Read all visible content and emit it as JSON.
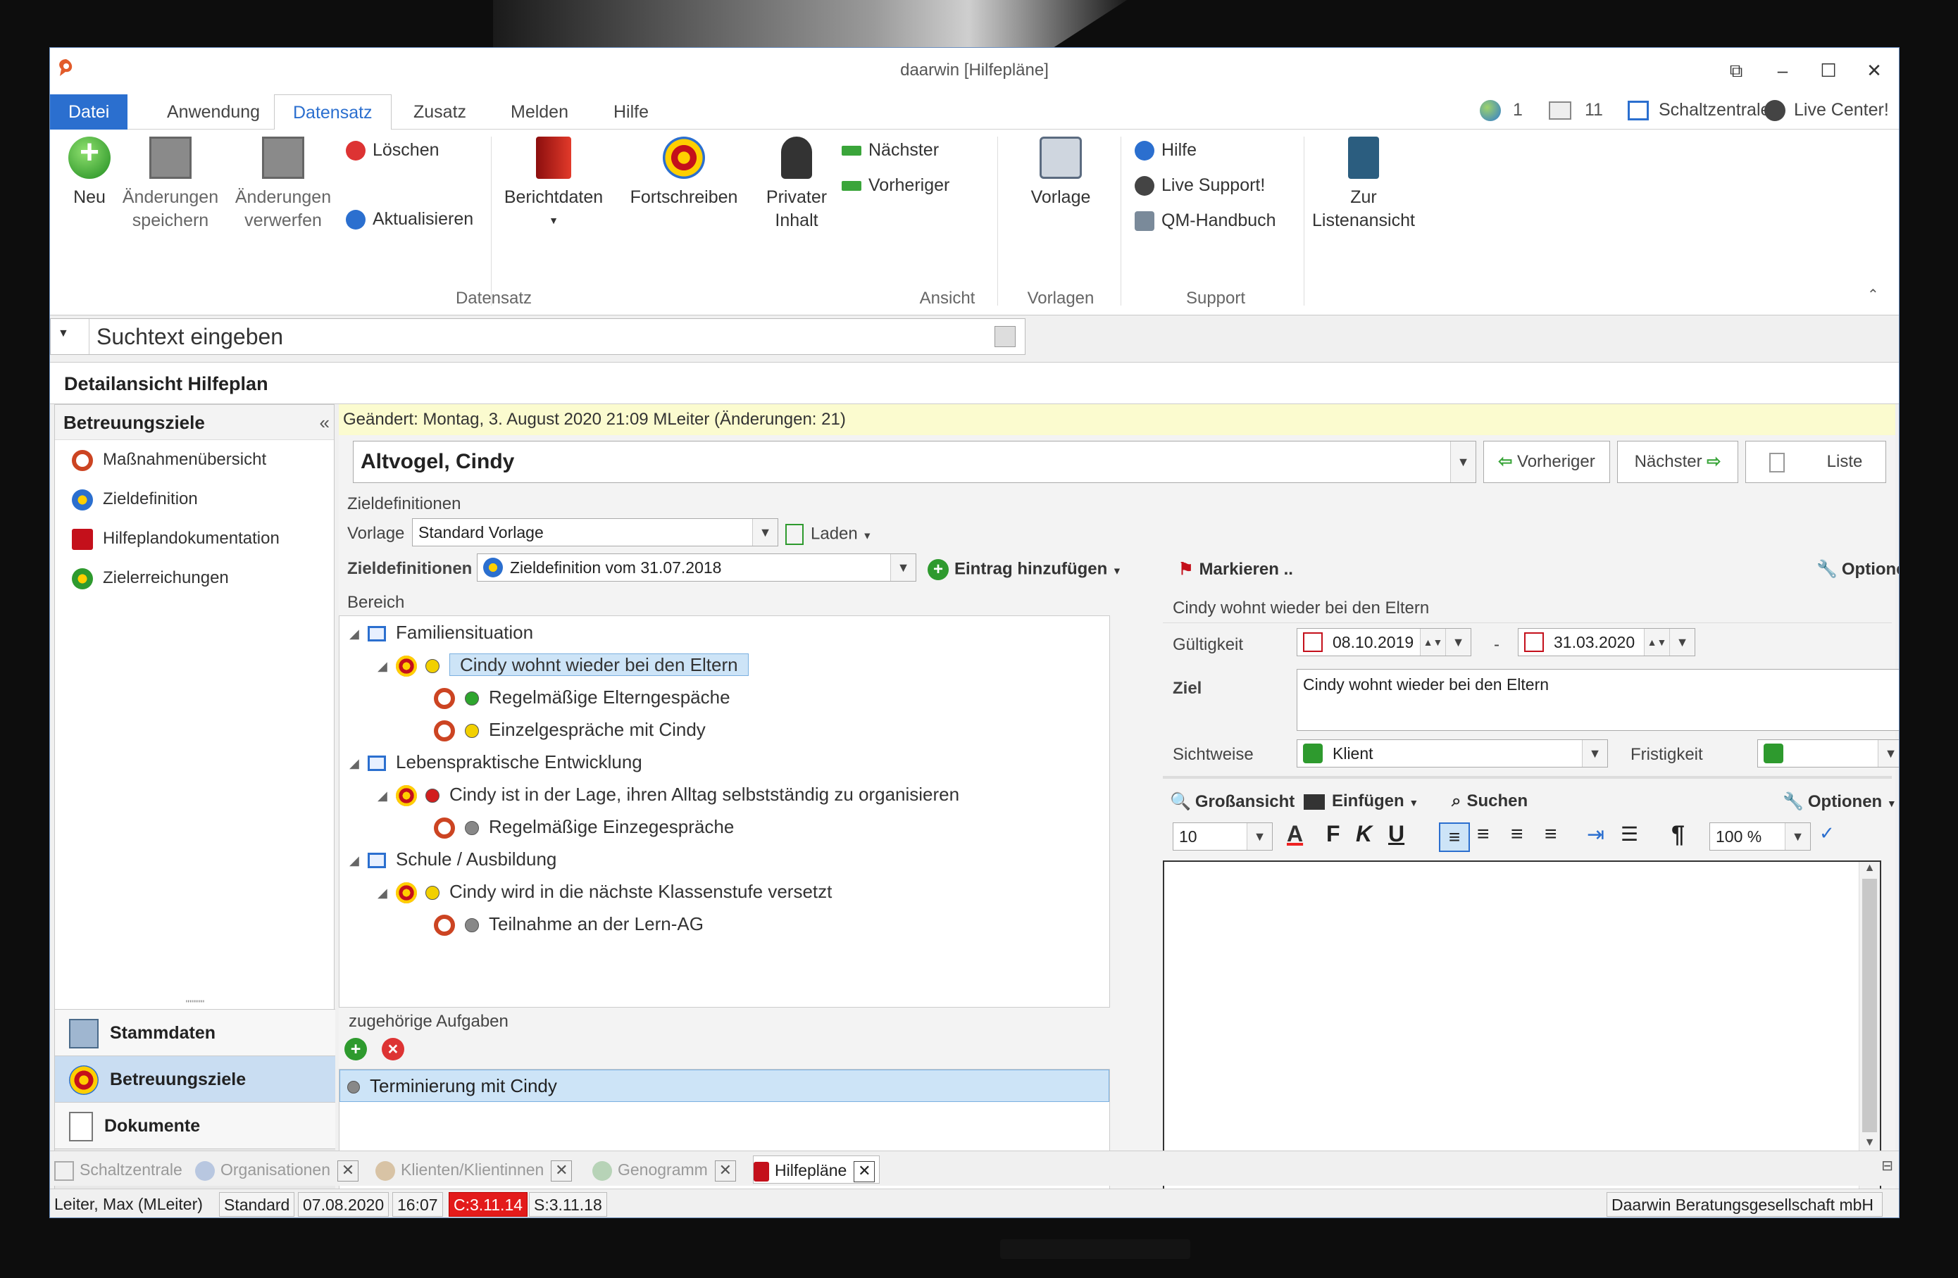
{
  "window": {
    "title": "daarwin [Hilfepläne]"
  },
  "ribbon_tabs": [
    "Datei",
    "Anwendung",
    "Datensatz",
    "Zusatz",
    "Melden",
    "Hilfe"
  ],
  "top_right": {
    "globe_count": "1",
    "mail_count": "11",
    "schaltzentrale": "Schaltzentrale",
    "live_center": "Live Center!"
  },
  "ribbon": {
    "neu": "Neu",
    "save_line1": "Änderungen",
    "save_line2": "speichern",
    "discard_line1": "Änderungen",
    "discard_line2": "verwerfen",
    "delete": "Löschen",
    "refresh": "Aktualisieren",
    "group_datensatz": "Datensatz",
    "berichtdaten": "Berichtdaten",
    "fortschreiben": "Fortschreiben",
    "privat_line1": "Privater",
    "privat_line2": "Inhalt",
    "next": "Nächster",
    "prev": "Vorheriger",
    "group_ansicht": "Ansicht",
    "vorlage": "Vorlage",
    "group_vorlagen": "Vorlagen",
    "hilfe": "Hilfe",
    "live_support": "Live Support!",
    "qm": "QM-Handbuch",
    "group_support": "Support",
    "list_line1": "Zur",
    "list_line2": "Listenansicht"
  },
  "search": {
    "placeholder": "Suchtext eingeben"
  },
  "detail_title": "Detailansicht Hilfeplan",
  "left": {
    "header": "Betreuungsziele",
    "items": [
      "Maßnahmenübersicht",
      "Zieldefinition",
      "Hilfeplandokumentation",
      "Zielerreichungen"
    ],
    "nav": [
      "Stammdaten",
      "Betreuungsziele",
      "Dokumente"
    ]
  },
  "main": {
    "changed": "Geändert: Montag, 3. August 2020 21:09  MLeiter  (Änderungen: 21)",
    "client": "Altvogel, Cindy",
    "btn_prev": "Vorheriger",
    "btn_next": "Nächster",
    "btn_list": "Liste",
    "section_title": "Zieldefinitionen",
    "vorlage_label": "Vorlage",
    "vorlage_value": "Standard Vorlage",
    "laden": "Laden",
    "zd_label": "Zieldefinitionen",
    "zd_value": "Zieldefinition vom 31.07.2018",
    "add_entry": "Eintrag hinzufügen",
    "mark": "Markieren ..",
    "options": "Optionen",
    "bereich": "Bereich",
    "tree": [
      {
        "level": 0,
        "text": "Familiensituation",
        "kind": "group"
      },
      {
        "level": 1,
        "text": "Cindy wohnt wieder bei den Eltern",
        "kind": "goal",
        "dot": "#f2d000",
        "selected": true
      },
      {
        "level": 2,
        "text": "Regelmäßige Elterngespäche",
        "kind": "task",
        "dot": "#2ea52e"
      },
      {
        "level": 2,
        "text": "Einzelgespräche mit Cindy",
        "kind": "task",
        "dot": "#f2d000"
      },
      {
        "level": 0,
        "text": "Lebenspraktische Entwicklung",
        "kind": "group"
      },
      {
        "level": 1,
        "text": "Cindy ist in der Lage, ihren Alltag selbstständig zu organisieren",
        "kind": "goal",
        "dot": "#d21f1f"
      },
      {
        "level": 2,
        "text": "Regelmäßige Einzegespräche",
        "kind": "task",
        "dot": "#888888"
      },
      {
        "level": 0,
        "text": "Schule / Ausbildung",
        "kind": "group"
      },
      {
        "level": 1,
        "text": "Cindy wird in die nächste Klassenstufe versetzt",
        "kind": "goal",
        "dot": "#f2d000"
      },
      {
        "level": 2,
        "text": "Teilnahme an der Lern-AG",
        "kind": "task",
        "dot": "#888888"
      }
    ],
    "tasks_title": "zugehörige Aufgaben",
    "task_item": "Terminierung mit Cindy"
  },
  "detail": {
    "header": "Cindy wohnt wieder bei den Eltern",
    "validity_label": "Gültigkeit",
    "from": "08.10.2019",
    "dash": "-",
    "to": "31.03.2020",
    "ziel_label": "Ziel",
    "ziel_value": "Cindy wohnt wieder bei den Eltern",
    "sichtweise_label": "Sichtweise",
    "sichtweise_value": "Klient",
    "frist_label": "Fristigkeit",
    "grossansicht": "Großansicht",
    "einfuegen": "Einfügen",
    "suchen": "Suchen",
    "options": "Optionen",
    "font_size": "10",
    "zoom": "100 %"
  },
  "doc_tabs": [
    "Schaltzentrale",
    "Organisationen",
    "Klienten/Klientinnen",
    "Genogramm",
    "Hilfepläne"
  ],
  "status": {
    "user": "Leiter, Max  (MLeiter)",
    "profile": "Standard",
    "date": "07.08.2020",
    "time": "16:07",
    "c_ver": "C:3.11.14",
    "s_ver": "S:3.11.18",
    "company": "Daarwin Beratungsgesellschaft mbH"
  }
}
